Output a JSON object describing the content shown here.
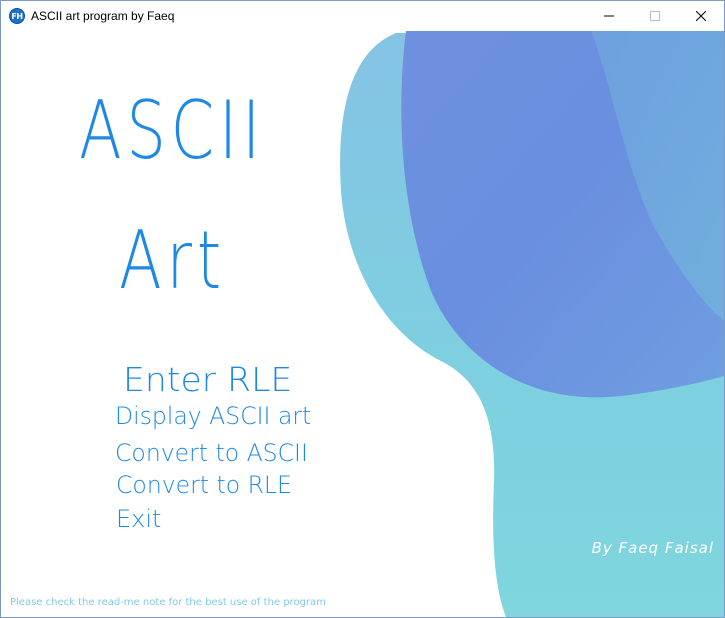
{
  "window": {
    "title": "ASCII art program by Faeq",
    "icon_glyph": "FH"
  },
  "controls": {
    "minimize_icon": "minimize-icon",
    "maximize_icon": "maximize-icon",
    "close_icon": "close-icon"
  },
  "main": {
    "title_line1": "ASCII",
    "title_line2": "Art",
    "menu": [
      {
        "label": "Enter RLE"
      },
      {
        "label": "Display ASCII art"
      },
      {
        "label": "Convert to ASCII"
      },
      {
        "label": "Convert to RLE"
      },
      {
        "label": "Exit"
      }
    ],
    "author": "By Faeq Faisal",
    "note": "Please check the read-me note for the best use of the program"
  },
  "colors": {
    "accent_text": "#1e88e5",
    "blob_light": "#7ec8e3",
    "blob_dark": "#6a8fe0",
    "note_text": "#80cbe8"
  }
}
